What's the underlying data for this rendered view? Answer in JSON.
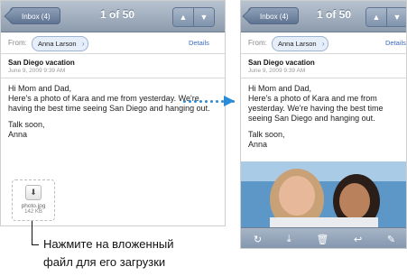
{
  "left_screen": {
    "nav": {
      "back_label": "Inbox (4)",
      "counter": "1 of 50",
      "up_glyph": "▲",
      "down_glyph": "▼"
    },
    "from_label": "From:",
    "sender": "Anna Larson",
    "details_label": "Details",
    "subject": "San Diego vacation",
    "date": "June 9, 2009 9:39 AM",
    "body": [
      "Hi Mom and Dad,",
      "Here's a photo of Kara and me from yesterday. We're having the best time seeing San Diego and hanging out.",
      "Talk soon,",
      "Anna"
    ],
    "attachment": {
      "icon": "download-icon",
      "filename": "photo.jpg",
      "size": "142 KB"
    }
  },
  "right_screen": {
    "nav": {
      "back_label": "Inbox (4)",
      "counter": "1 of 50",
      "up_glyph": "▲",
      "down_glyph": "▼"
    },
    "from_label": "From:",
    "sender": "Anna Larson",
    "details_label": "Details",
    "subject": "San Diego vacation",
    "date": "June 9, 2009 9:39 AM",
    "body": [
      "Hi Mom and Dad,",
      "Here's a photo of Kara and me from yesterday. We're having the best time seeing San Diego and hanging out.",
      "Talk soon,",
      "Anna"
    ],
    "toolbar": {
      "refresh": "↻",
      "move": "⤓",
      "trash": "🗑",
      "reply": "↩",
      "compose": "✎"
    }
  },
  "caption": {
    "line1": "Нажмите на вложенный",
    "line2": "файл для его загрузки"
  },
  "colors": {
    "arrow": "#2a8cd6",
    "nav": "#8d9cae",
    "link": "#3b6ac0"
  }
}
